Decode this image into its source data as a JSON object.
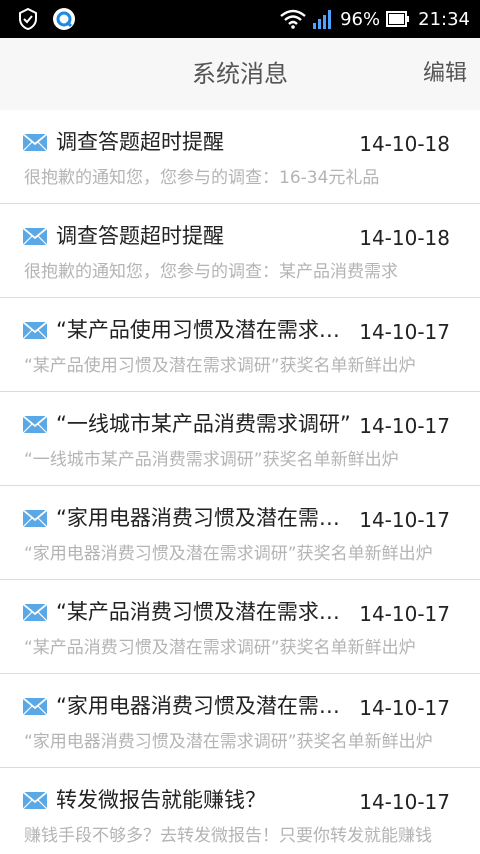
{
  "status_bar": {
    "battery_percent": "96%",
    "time": "21:34",
    "icons": [
      "notification-icon",
      "app-icon",
      "wifi-icon",
      "signal-icon",
      "battery-icon"
    ]
  },
  "header": {
    "title": "系统消息",
    "edit_label": "编辑"
  },
  "messages": [
    {
      "title": "调查答题超时提醒",
      "date": "14-10-18",
      "preview": "很抱歉的通知您，您参与的调查：16-34元礼品"
    },
    {
      "title": "调查答题超时提醒",
      "date": "14-10-18",
      "preview": "很抱歉的通知您，您参与的调查：某产品消费需求"
    },
    {
      "title": "“某产品使用习惯及潜在需求调研”",
      "date": "14-10-17",
      "preview": "“某产品使用习惯及潜在需求调研”获奖名单新鲜出炉"
    },
    {
      "title": "“一线城市某产品消费需求调研”",
      "date": "14-10-17",
      "preview": "“一线城市某产品消费需求调研”获奖名单新鲜出炉"
    },
    {
      "title": "“家用电器消费习惯及潜在需求调研”",
      "date": "14-10-17",
      "preview": "“家用电器消费习惯及潜在需求调研”获奖名单新鲜出炉"
    },
    {
      "title": "“某产品消费习惯及潜在需求调研”",
      "date": "14-10-17",
      "preview": "“某产品消费习惯及潜在需求调研”获奖名单新鲜出炉"
    },
    {
      "title": "“家用电器消费习惯及潜在需求调研”",
      "date": "14-10-17",
      "preview": "“家用电器消费习惯及潜在需求调研”获奖名单新鲜出炉"
    },
    {
      "title": "转发微报告就能赚钱？",
      "date": "14-10-17",
      "preview": "赚钱手段不够多？去转发微报告！只要你转发就能赚钱"
    }
  ],
  "colors": {
    "icon_blue": "#5aa9e6",
    "title_text": "#222222",
    "preview_text": "#b4b4b4",
    "header_bg": "#f7f7f7",
    "divider": "#dcdcdc"
  }
}
